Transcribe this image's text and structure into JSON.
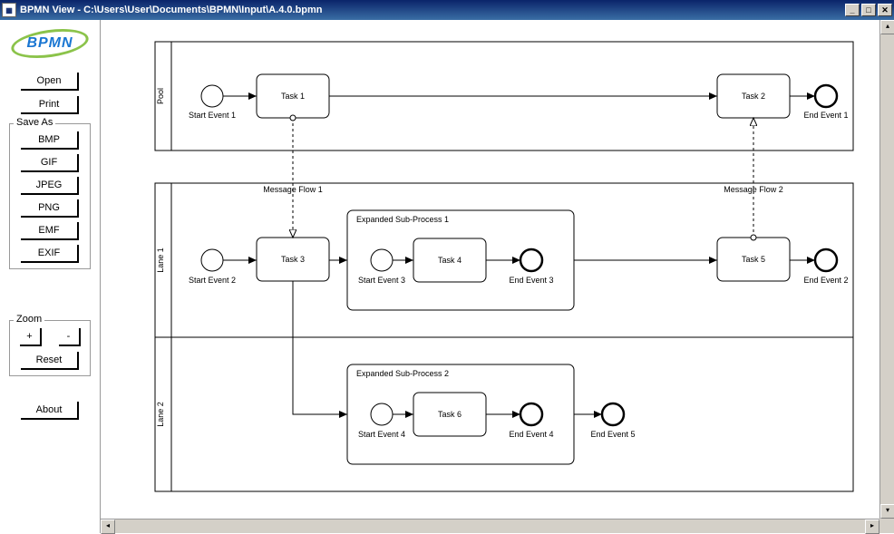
{
  "window": {
    "title": "BPMN View - C:\\Users\\User\\Documents\\BPMN\\Input\\A.4.0.bpmn"
  },
  "logo": {
    "text": "BPMN"
  },
  "buttons": {
    "open": "Open",
    "print": "Print",
    "about": "About"
  },
  "saveas": {
    "legend": "Save As",
    "bmp": "BMP",
    "gif": "GIF",
    "jpeg": "JPEG",
    "png": "PNG",
    "emf": "EMF",
    "exif": "EXIF"
  },
  "zoom": {
    "legend": "Zoom",
    "in": "+",
    "out": "-",
    "reset": "Reset"
  },
  "diagram": {
    "pool1": {
      "label": "Pool"
    },
    "pool2_lane1": {
      "label": "Lane 1"
    },
    "pool2_lane2": {
      "label": "Lane 2"
    },
    "start1": "Start Event 1",
    "task1": "Task 1",
    "task2": "Task 2",
    "end1": "End Event 1",
    "mf1": "Message Flow 1",
    "mf2": "Message Flow 2",
    "start2": "Start Event 2",
    "task3": "Task 3",
    "sub1": "Expanded Sub-Process 1",
    "start3": "Start Event 3",
    "task4": "Task 4",
    "end3": "End Event 3",
    "task5": "Task 5",
    "end2": "End Event 2",
    "sub2": "Expanded Sub-Process 2",
    "start4": "Start Event 4",
    "task6": "Task 6",
    "end4": "End Event 4",
    "end5": "End Event 5"
  }
}
